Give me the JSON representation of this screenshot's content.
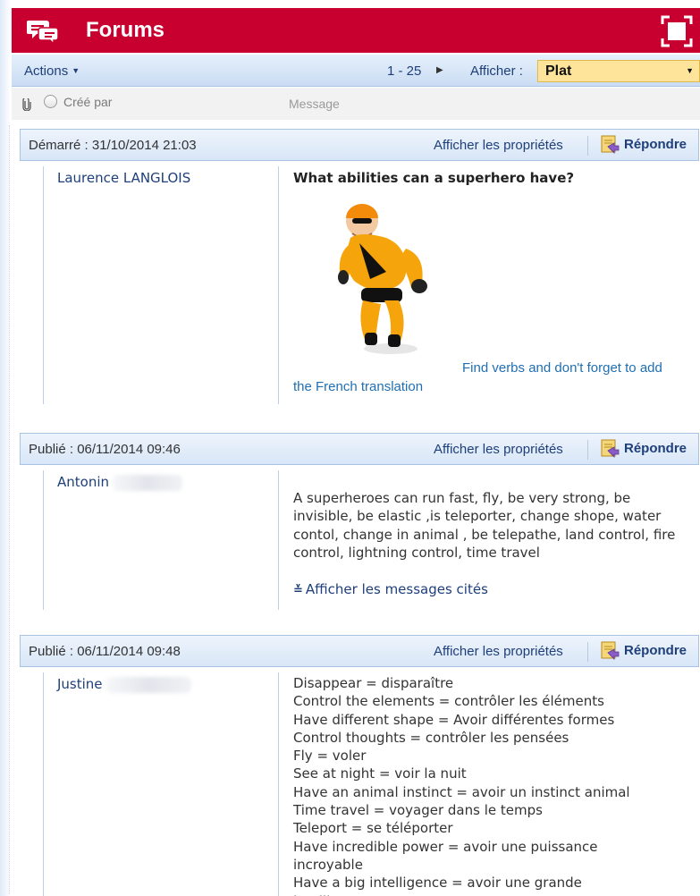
{
  "app": {
    "title": "Forums",
    "icon": "forum-chat-icon",
    "maximize_icon": "maximize-icon",
    "brand_color": "#c8002f"
  },
  "toolbar": {
    "actions_label": "Actions",
    "paging": "1 - 25",
    "view_label": "Afficher :",
    "view_value": "Plat"
  },
  "columns": {
    "created_by": "Créé par",
    "message": "Message"
  },
  "common": {
    "properties_link": "Afficher les propriétés",
    "reply_label": "Répondre"
  },
  "posts": [
    {
      "date": "Démarré : 31/10/2014 21:03",
      "author": "Laurence LANGLOIS",
      "subject": "What abilities can a superhero have?",
      "image": "superhero-figure",
      "link_text_1": "Find verbs and don't forget to add",
      "link_text_2": "the French translation"
    },
    {
      "date": "Publié : 06/11/2014 09:46",
      "author": "Antonin",
      "body": "A superheroes can run fast, fly, be very strong, be invisible, be elastic ,is teleporter, change shope, water contol, change in animal , be telepathe, land control, fire control, lightning control, time travel",
      "quoted_link": "Afficher les messages cités"
    },
    {
      "date": "Publié : 06/11/2014 09:48",
      "author": "Justine",
      "lines": [
        "Disappear  = disparaître",
        "Control the elements = contrôler les éléments",
        "Have different shape = Avoir différentes formes",
        "Control thoughts = contrôler les pensées",
        "Fly = voler",
        "See at night = voir la nuit",
        "Have an animal instinct = avoir un instinct animal",
        "Time travel = voyager dans le temps",
        "Teleport = se téléporter",
        "Have incredible power = avoir une puissance",
        "incroyable",
        "Have a big intelligence = avoir une grande",
        "intelligence"
      ]
    }
  ]
}
